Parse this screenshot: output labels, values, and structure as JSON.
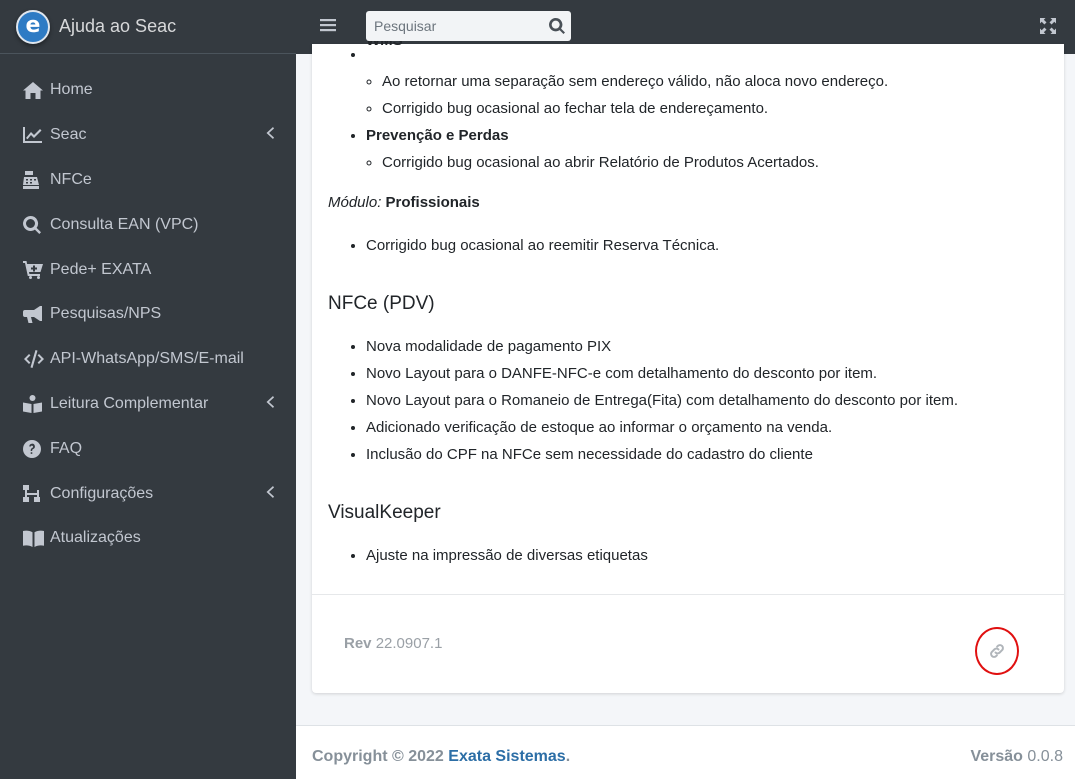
{
  "brand": {
    "title": "Ajuda ao Seac",
    "logo_letter": "e"
  },
  "topbar": {
    "search_placeholder": "Pesquisar"
  },
  "sidebar": {
    "items": [
      {
        "label": "Home",
        "icon": "home-icon"
      },
      {
        "label": "Seac",
        "icon": "chart-line-icon",
        "has_arrow": true
      },
      {
        "label": "NFCe",
        "icon": "cash-register-icon"
      },
      {
        "label": "Consulta EAN (VPC)",
        "icon": "search-icon"
      },
      {
        "label": "Pede+ EXATA",
        "icon": "cart-plus-icon"
      },
      {
        "label": "Pesquisas/NPS",
        "icon": "bullhorn-icon"
      },
      {
        "label": "API-WhatsApp/SMS/E-mail",
        "icon": "code-icon"
      },
      {
        "label": "Leitura Complementar",
        "icon": "book-reader-icon",
        "has_arrow": true
      },
      {
        "label": "FAQ",
        "icon": "question-circle-icon"
      },
      {
        "label": "Configurações",
        "icon": "sitemap-icon",
        "has_arrow": true
      },
      {
        "label": "Atualizações",
        "icon": "book-open-icon"
      }
    ]
  },
  "article": {
    "cut_heading": "WMS",
    "wms_items": [
      "Ao retornar uma separação sem endereço válido, não aloca novo endereço.",
      "Corrigido bug ocasional ao fechar tela de endereçamento."
    ],
    "prevencao_heading": "Prevenção e Perdas",
    "prevencao_items": [
      "Corrigido bug ocasional ao abrir Relatório de Produtos Acertados."
    ],
    "modulo_label": "Módulo:",
    "modulo_name": "Profissionais",
    "profissionais_items": [
      "Corrigido bug ocasional ao reemitir Reserva Técnica."
    ],
    "nfce_heading": "NFCe (PDV)",
    "nfce_items": [
      "Nova modalidade de pagamento PIX",
      "Novo Layout para o DANFE-NFC-e com detalhamento do desconto por item.",
      "Novo Layout para o Romaneio de Entrega(Fita) com detalhamento do desconto por item.",
      "Adicionado verificação de estoque ao informar o orçamento na venda.",
      "Inclusão do CPF na NFCe sem necessidade do cadastro do cliente"
    ],
    "visualkeeper_heading": "VisualKeeper",
    "visualkeeper_items": [
      "Ajuste na impressão de diversas etiquetas"
    ]
  },
  "card_footer": {
    "rev_label": "Rev",
    "rev_value": "22.0907.1"
  },
  "footer": {
    "copyright_prefix": "Copyright © 2022",
    "company": "Exata Sistemas",
    "suffix": ".",
    "version_label": "Versão",
    "version_value": "0.0.8"
  },
  "colors": {
    "sidebar_bg": "#343a40",
    "link": "#2c6ea6",
    "highlight_ring": "#e01010"
  }
}
